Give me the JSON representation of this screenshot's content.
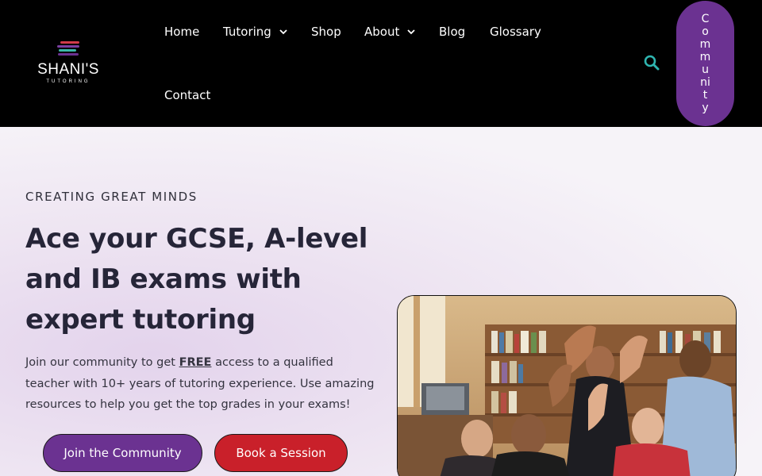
{
  "logo": {
    "name": "SHANI'S",
    "sub": "TUTORING",
    "bar_colors": [
      "#d23b4b",
      "#7b3fa0",
      "#3bb9a8",
      "#6b3291"
    ]
  },
  "nav": {
    "home": "Home",
    "tutoring": "Tutoring",
    "shop": "Shop",
    "about": "About",
    "blog": "Blog",
    "glossary": "Glossary",
    "contact": "Contact"
  },
  "header": {
    "search_icon": "search-icon",
    "community_letters": [
      "C",
      "o",
      "m",
      "m",
      "u",
      "ni",
      "t",
      "y"
    ]
  },
  "hero": {
    "eyebrow": "CREATING GREAT MINDS",
    "headline": "Ace your GCSE, A-level and IB exams with expert tutoring",
    "intro_before": "Join our community to get ",
    "intro_free": "FREE",
    "intro_after": " access to a qualified teacher with 10+ years of tutoring experience. Use amazing resources to help you get the top grades in your exams!",
    "join_button": "Join the Community",
    "book_button": "Book a Session"
  },
  "colors": {
    "accent_purple": "#6b3291",
    "accent_red": "#c9202a",
    "search_teal": "#2fb5b0",
    "header_bg": "#000000"
  }
}
